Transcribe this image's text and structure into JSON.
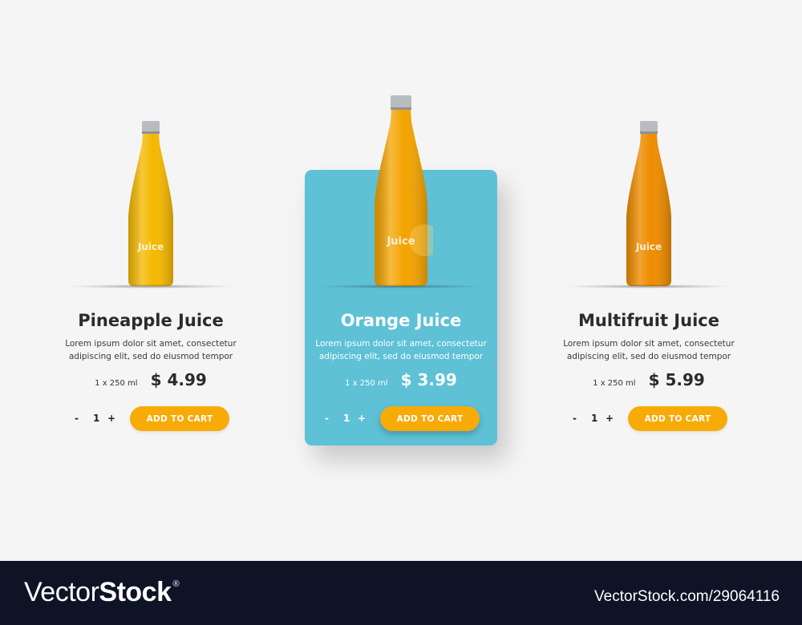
{
  "products": [
    {
      "name": "Pineapple Juice",
      "description_line1": "Lorem ipsum dolor sit amet, consectetur",
      "description_line2": "adipiscing elit, sed do eiusmod tempor",
      "volume": "1 x 250 ml",
      "price": "$ 4.99",
      "bottle_label": "Juice",
      "quantity": "1",
      "minus": "-",
      "plus": "+",
      "cart_label": "ADD TO CART",
      "juice_color": "#f5b800",
      "featured": false
    },
    {
      "name": "Orange Juice",
      "description_line1": "Lorem ipsum dolor sit amet, consectetur",
      "description_line2": "adipiscing elit, sed do eiusmod tempor",
      "volume": "1 x 250 ml",
      "price": "$ 3.99",
      "bottle_label": "Juice",
      "quantity": "1",
      "minus": "-",
      "plus": "+",
      "cart_label": "ADD TO CART",
      "juice_color": "#f3a300",
      "featured": true
    },
    {
      "name": "Multifruit Juice",
      "description_line1": "Lorem ipsum dolor sit amet, consectetur",
      "description_line2": "adipiscing elit, sed do eiusmod tempor",
      "volume": "1 x 250 ml",
      "price": "$ 5.99",
      "bottle_label": "Juice",
      "quantity": "1",
      "minus": "-",
      "plus": "+",
      "cart_label": "ADD TO CART",
      "juice_color": "#ee8c00",
      "featured": false
    }
  ],
  "colors": {
    "background": "#f5f5f5",
    "featured_card": "#5ec1d5",
    "button": "#f8ab07",
    "footer": "#0f1326"
  },
  "footer": {
    "brand_regular": "Vector",
    "brand_bold": "Stock",
    "registered": "®",
    "image_id": "VectorStock.com/29064116"
  }
}
